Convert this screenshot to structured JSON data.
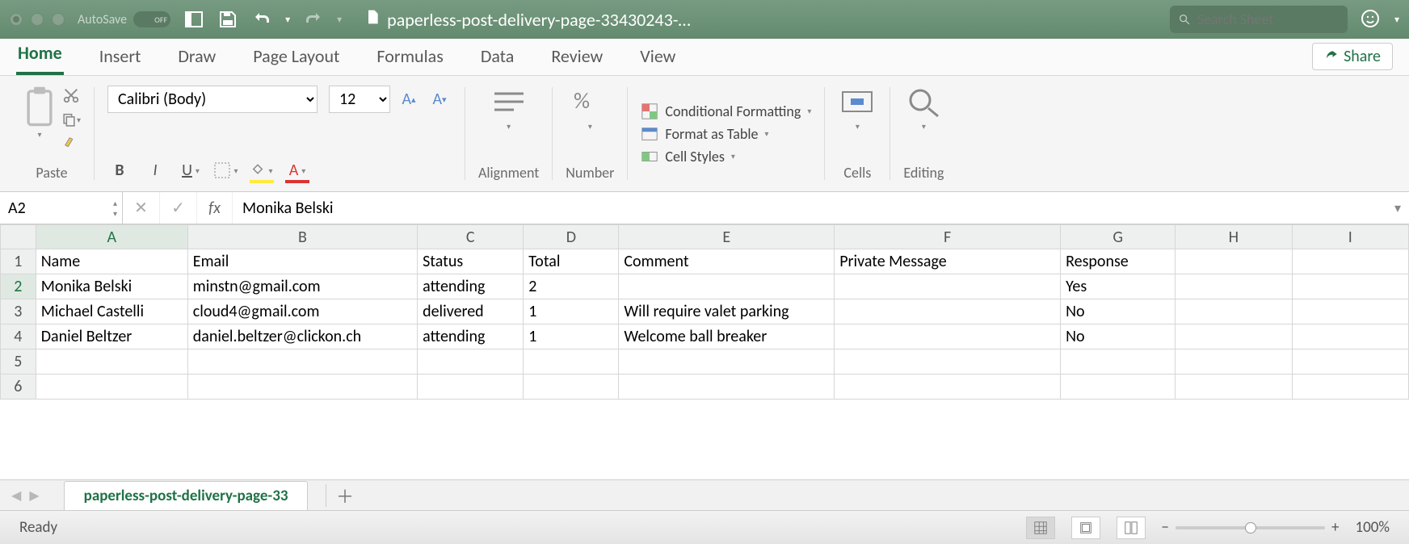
{
  "titlebar": {
    "autosave_label": "AutoSave",
    "autosave_state": "OFF",
    "doc_name": "paperless-post-delivery-page-33430243-…",
    "search_placeholder": "Search Sheet"
  },
  "ribbon": {
    "tabs": [
      "Home",
      "Insert",
      "Draw",
      "Page Layout",
      "Formulas",
      "Data",
      "Review",
      "View"
    ],
    "active_tab": "Home",
    "share_label": "Share",
    "paste_label": "Paste",
    "font_name": "Calibri (Body)",
    "font_size": "12",
    "alignment_label": "Alignment",
    "number_label": "Number",
    "cond_fmt": "Conditional Formatting",
    "fmt_table": "Format as Table",
    "cell_styles": "Cell Styles",
    "cells_label": "Cells",
    "editing_label": "Editing"
  },
  "formula": {
    "cell_ref": "A2",
    "fx": "fx",
    "value": "Monika Belski"
  },
  "grid": {
    "columns": [
      "A",
      "B",
      "C",
      "D",
      "E",
      "F",
      "G",
      "H",
      "I"
    ],
    "headers": [
      "Name",
      "Email",
      "Status",
      "Total",
      "Comment",
      "Private Message",
      "Response",
      "",
      ""
    ],
    "rows": [
      [
        "Monika Belski",
        "minstn@gmail.com",
        "attending",
        "2",
        "",
        "",
        "Yes",
        "",
        ""
      ],
      [
        "Michael Castelli",
        "cloud4@gmail.com",
        "delivered",
        "1",
        "Will require valet parking",
        "",
        "No",
        "",
        ""
      ],
      [
        "Daniel Beltzer",
        "daniel.beltzer@clickon.ch",
        "attending",
        "1",
        "Welcome ball breaker",
        "",
        "No",
        "",
        ""
      ],
      [
        "",
        "",
        "",
        "",
        "",
        "",
        "",
        "",
        ""
      ],
      [
        "",
        "",
        "",
        "",
        "",
        "",
        "",
        "",
        ""
      ]
    ]
  },
  "sheet": {
    "tab_name": "paperless-post-delivery-page-33"
  },
  "status": {
    "label": "Ready",
    "zoom": "100%"
  }
}
